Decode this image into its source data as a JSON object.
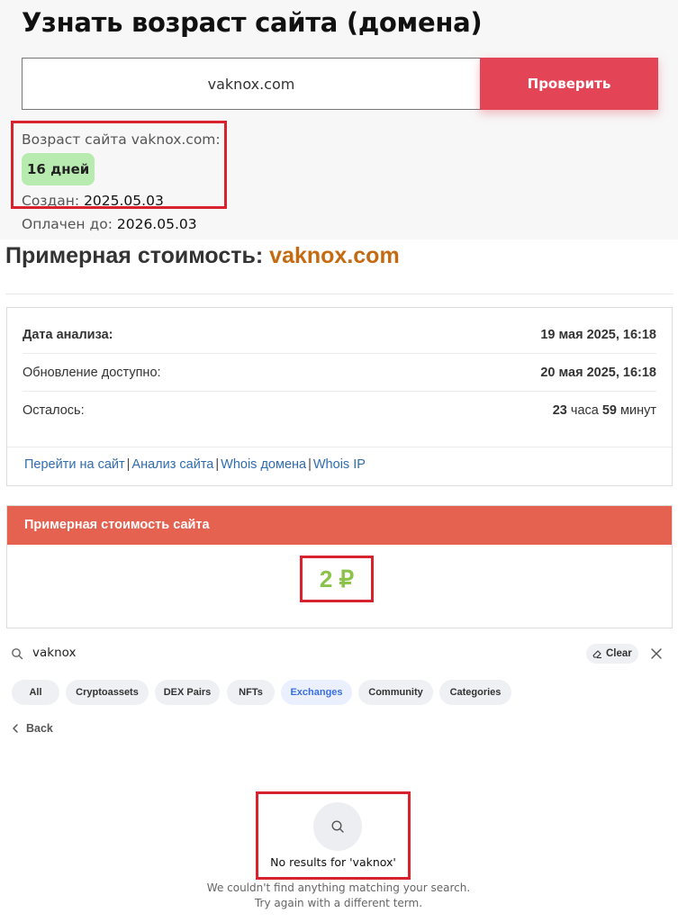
{
  "age_checker": {
    "title": "Узнать возраст сайта (домена)",
    "input_value": "vaknox.com",
    "check_button": "Проверить",
    "age_label": "Возраст сайта vaknox.com:",
    "age_value": "16 дней",
    "created_label": "Создан:",
    "created_value": "2025.05.03",
    "paid_label": "Оплачен до:",
    "paid_value": "2026.05.03",
    "badge_color": "#b8ebb0",
    "button_color": "#e34557",
    "highlight_color": "#d8232e"
  },
  "cost": {
    "title_prefix": "Примерная стоимость:",
    "title_domain": "vaknox.com",
    "domain_color": "#c56a10",
    "analysis_date_label": "Дата анализа:",
    "analysis_date_value": "19 мая 2025, 16:18",
    "update_label": "Обновление доступно:",
    "update_value": "20 мая 2025, 16:18",
    "remaining_label": "Осталось:",
    "remaining_hours": "23",
    "remaining_hours_unit": "часа",
    "remaining_minutes": "59",
    "remaining_minutes_unit": "минут",
    "links": [
      "Перейти на сайт",
      "Анализ сайта",
      "Whois домена",
      "Whois IP"
    ],
    "value_header": "Примерная стоимость сайта",
    "value_amount": "2 ₽",
    "header_color": "#e56150",
    "value_color": "#8bc34a"
  },
  "search": {
    "query": "vaknox",
    "clear_label": "Clear",
    "tabs": [
      "All",
      "Cryptoassets",
      "DEX Pairs",
      "NFTs",
      "Exchanges",
      "Community",
      "Categories"
    ],
    "active_tab": "Exchanges",
    "back_label": "Back",
    "empty_title": "No results for 'vaknox'",
    "empty_line1": "We couldn't find anything matching your search.",
    "empty_line2": "Try again with a different term.",
    "icons": [
      "search-icon",
      "eraser-icon",
      "close-icon",
      "chevron-left-icon"
    ]
  }
}
